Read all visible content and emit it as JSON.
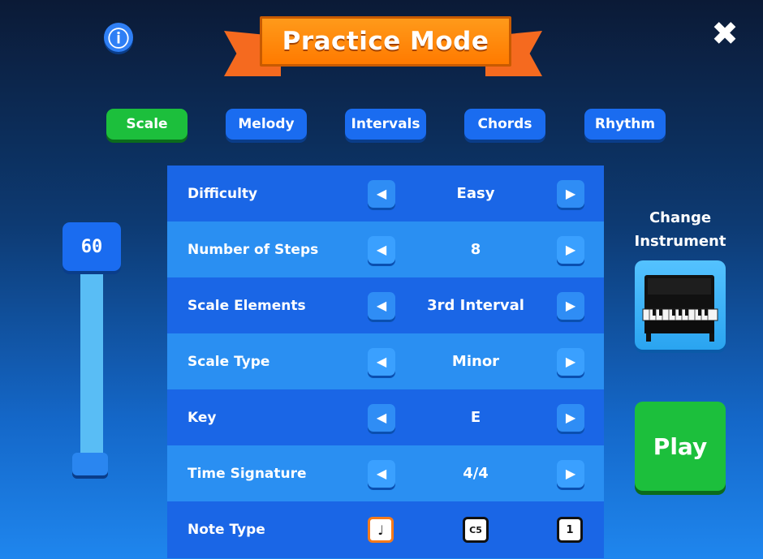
{
  "header": {
    "info_icon": "ⓘ",
    "title": "Practice Mode",
    "close_icon": "✖"
  },
  "tabs": [
    {
      "label": "Scale",
      "active": true
    },
    {
      "label": "Melody",
      "active": false
    },
    {
      "label": "Intervals",
      "active": false
    },
    {
      "label": "Chords",
      "active": false
    },
    {
      "label": "Rhythm",
      "active": false
    }
  ],
  "tempo": {
    "value": "60"
  },
  "settings": [
    {
      "label": "Difficulty",
      "value": "Easy"
    },
    {
      "label": "Number of Steps",
      "value": "8"
    },
    {
      "label": "Scale Elements",
      "value": "3rd Interval"
    },
    {
      "label": "Scale Type",
      "value": "Minor"
    },
    {
      "label": "Key",
      "value": "E"
    },
    {
      "label": "Time Signature",
      "value": "4/4"
    }
  ],
  "note_type": {
    "label": "Note Type",
    "options": [
      {
        "icon": "note-face-icon",
        "glyph": "♩",
        "selected": true
      },
      {
        "icon": "c5-icon",
        "glyph": "C5",
        "selected": false
      },
      {
        "icon": "number-one-icon",
        "glyph": "1",
        "selected": false
      }
    ]
  },
  "instrument": {
    "label": "Change Instrument",
    "icon": "upright-piano-icon"
  },
  "play": {
    "label": "Play"
  },
  "colors": {
    "accent_green": "#1cbf3c",
    "tab_blue": "#1a6cf0",
    "banner_orange": "#ff7a00"
  }
}
